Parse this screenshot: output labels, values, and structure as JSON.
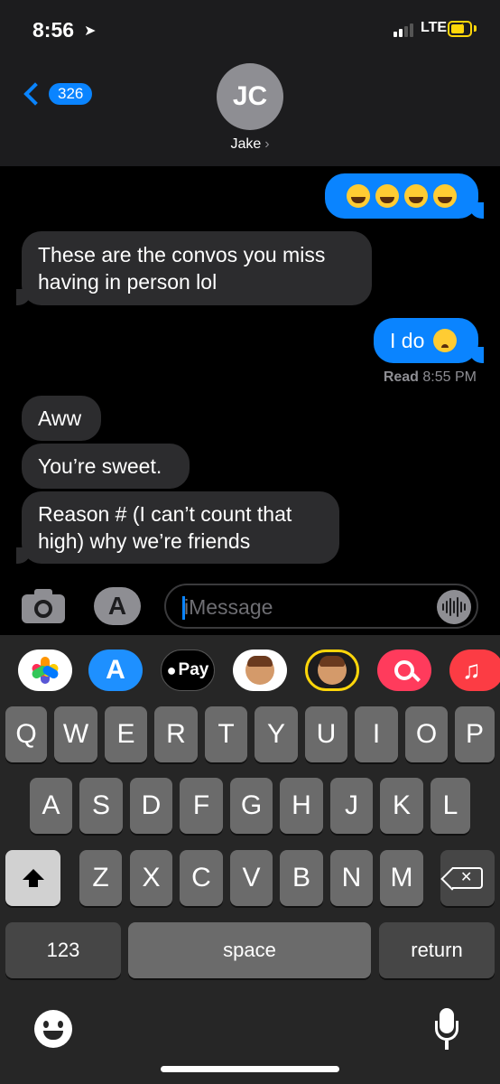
{
  "status_bar": {
    "time": "8:56",
    "network": "LTE"
  },
  "header": {
    "back_count": "326",
    "avatar_initials": "JC",
    "contact_name": "Jake"
  },
  "messages": [
    {
      "from": "me",
      "text": ""
    },
    {
      "from": "them",
      "text": "These are the convos you miss having in person lol"
    },
    {
      "from": "me",
      "text": "I do"
    },
    {
      "from": "them",
      "text": "Aww"
    },
    {
      "from": "them",
      "text": "You’re sweet."
    },
    {
      "from": "them",
      "text": "Reason # (I can’t count that high) why we’re friends"
    }
  ],
  "read_receipt": {
    "label": "Read",
    "time": "8:55 PM"
  },
  "compose": {
    "placeholder": "iMessage"
  },
  "app_drawer": {
    "apple_pay_label": "Pay"
  },
  "keyboard": {
    "row1": [
      "Q",
      "W",
      "E",
      "R",
      "T",
      "Y",
      "U",
      "I",
      "O",
      "P"
    ],
    "row2": [
      "A",
      "S",
      "D",
      "F",
      "G",
      "H",
      "J",
      "K",
      "L"
    ],
    "row3": [
      "Z",
      "X",
      "C",
      "V",
      "B",
      "N",
      "M"
    ],
    "numbers_label": "123",
    "space_label": "space",
    "return_label": "return"
  },
  "colors": {
    "accent": "#0a84ff",
    "incoming_bubble": "#2c2c2e",
    "battery": "#ffd60a"
  }
}
